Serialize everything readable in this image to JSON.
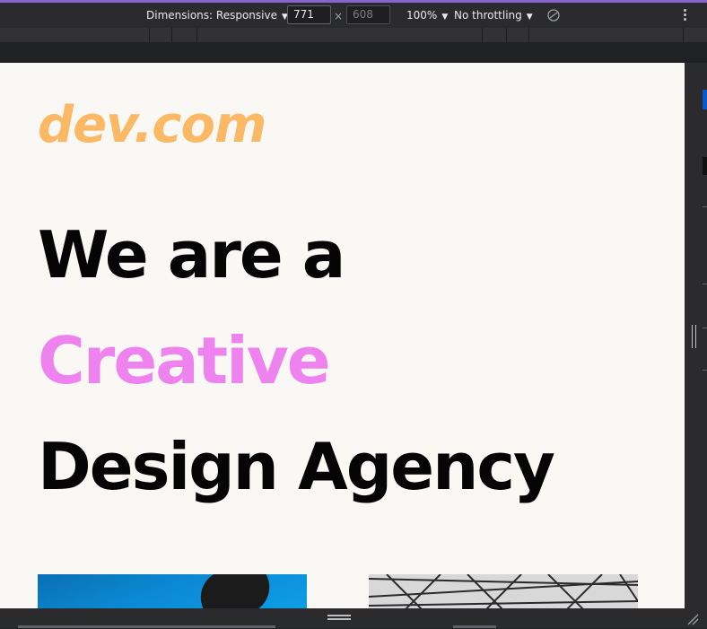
{
  "devtools": {
    "dimensions_label": "Dimensions: Responsive",
    "width_value": "771",
    "height_value": "608",
    "times_symbol": "×",
    "zoom": "100%",
    "throttling": "No throttling",
    "caret": "▼",
    "rotate_icon": "rotate-icon",
    "menu_icon": "more-vert-icon"
  },
  "page": {
    "logo": "dev.com",
    "headline_line1": "We are a",
    "headline_line2": "Creative",
    "headline_line3": "Design Agency",
    "colors": {
      "background": "#faf8f5",
      "logo": "#fbb865",
      "accent": "#ee82ee",
      "text": "#050505"
    }
  }
}
